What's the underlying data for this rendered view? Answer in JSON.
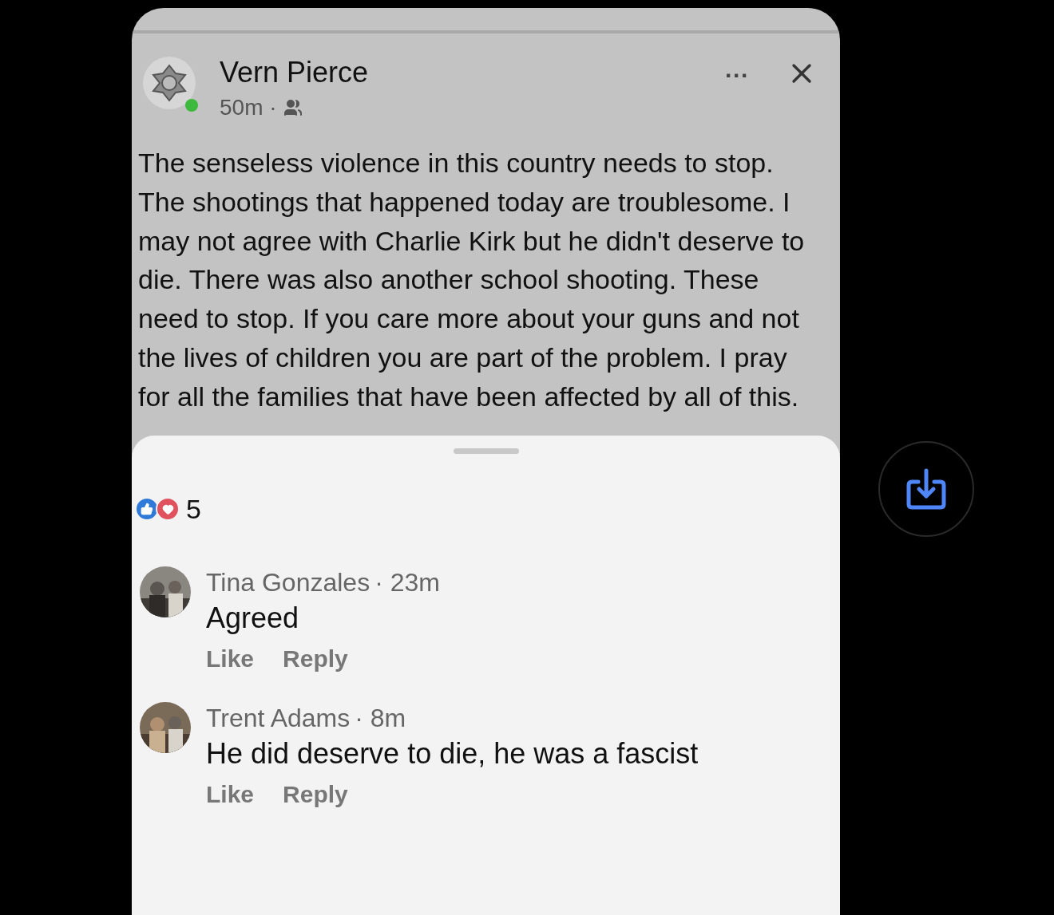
{
  "post": {
    "author": "Vern Pierce",
    "online": true,
    "time": "50m ·",
    "body": "The senseless violence in this country needs to stop. The shootings that happened today are troublesome. I may not agree with Charlie Kirk but he didn't deserve to die. There was also another school shooting. These need to stop. If you care more about your guns and not the lives of children you are part of the problem. I pray for all the families that have been affected by all of this.",
    "menu": "···"
  },
  "reactions": {
    "count": "5"
  },
  "comments": [
    {
      "name": "Tina Gonzales",
      "time": "· 23m",
      "text": "Agreed",
      "actions": [
        "Like",
        "Reply"
      ]
    },
    {
      "name": "Trent Adams",
      "time": "· 8m",
      "text": "He did deserve to die, he was a fascist",
      "actions": [
        "Like",
        "Reply"
      ]
    }
  ]
}
